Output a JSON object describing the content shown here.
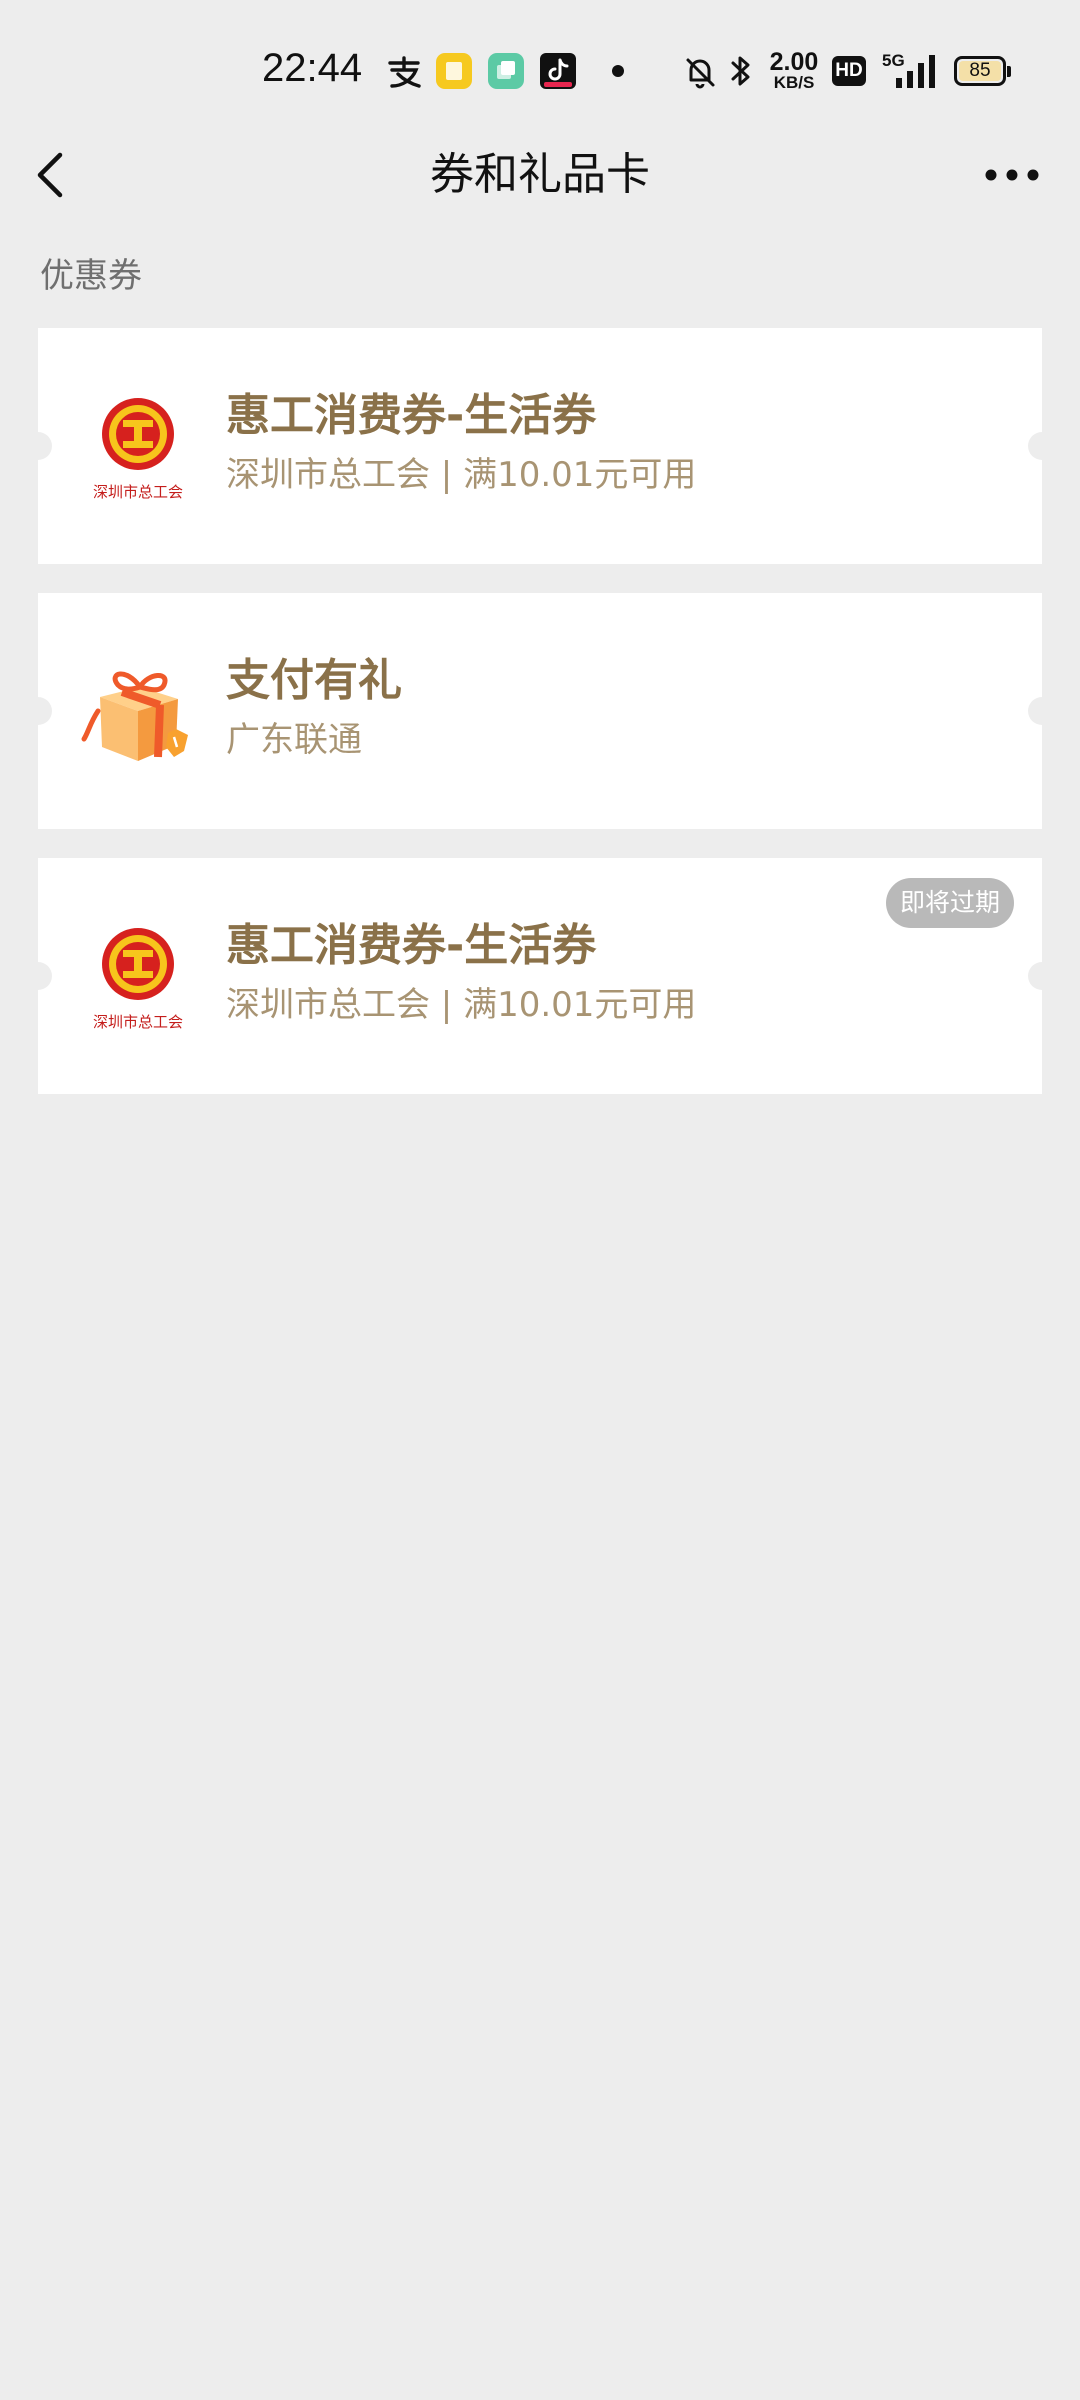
{
  "status_bar": {
    "time": "22:44",
    "net_speed": "2.00",
    "net_unit": "KB/S",
    "network_type": "5G",
    "hd_label": "HD",
    "battery": "85",
    "icons": [
      "alipay-icon",
      "notes-app-icon",
      "clone-app-icon",
      "tiktok-icon",
      "dot-icon",
      "mute-bell-icon",
      "bluetooth-icon",
      "hd-icon",
      "signal-icon",
      "battery-icon"
    ]
  },
  "nav": {
    "title": "券和礼品卡",
    "back_icon": "chevron-left-icon",
    "more_icon": "more-dots-icon"
  },
  "section": {
    "title": "优惠券"
  },
  "coupons": [
    {
      "title": "惠工消费券-生活券",
      "subtitle": "深圳市总工会 | 满10.01元可用",
      "logo": "union-emblem-icon",
      "logo_caption": "深圳市总工会",
      "badge": ""
    },
    {
      "title": "支付有礼",
      "subtitle": "广东联通",
      "logo": "gift-box-icon",
      "badge": ""
    },
    {
      "title": "惠工消费券-生活券",
      "subtitle": "深圳市总工会 | 满10.01元可用",
      "logo": "union-emblem-icon",
      "logo_caption": "深圳市总工会",
      "badge": "即将过期"
    }
  ],
  "colors": {
    "background": "#ededed",
    "card": "#ffffff",
    "coupon_title": "#8a7149",
    "coupon_subtitle": "#a89473",
    "badge_bg": "#b9b9b9"
  }
}
